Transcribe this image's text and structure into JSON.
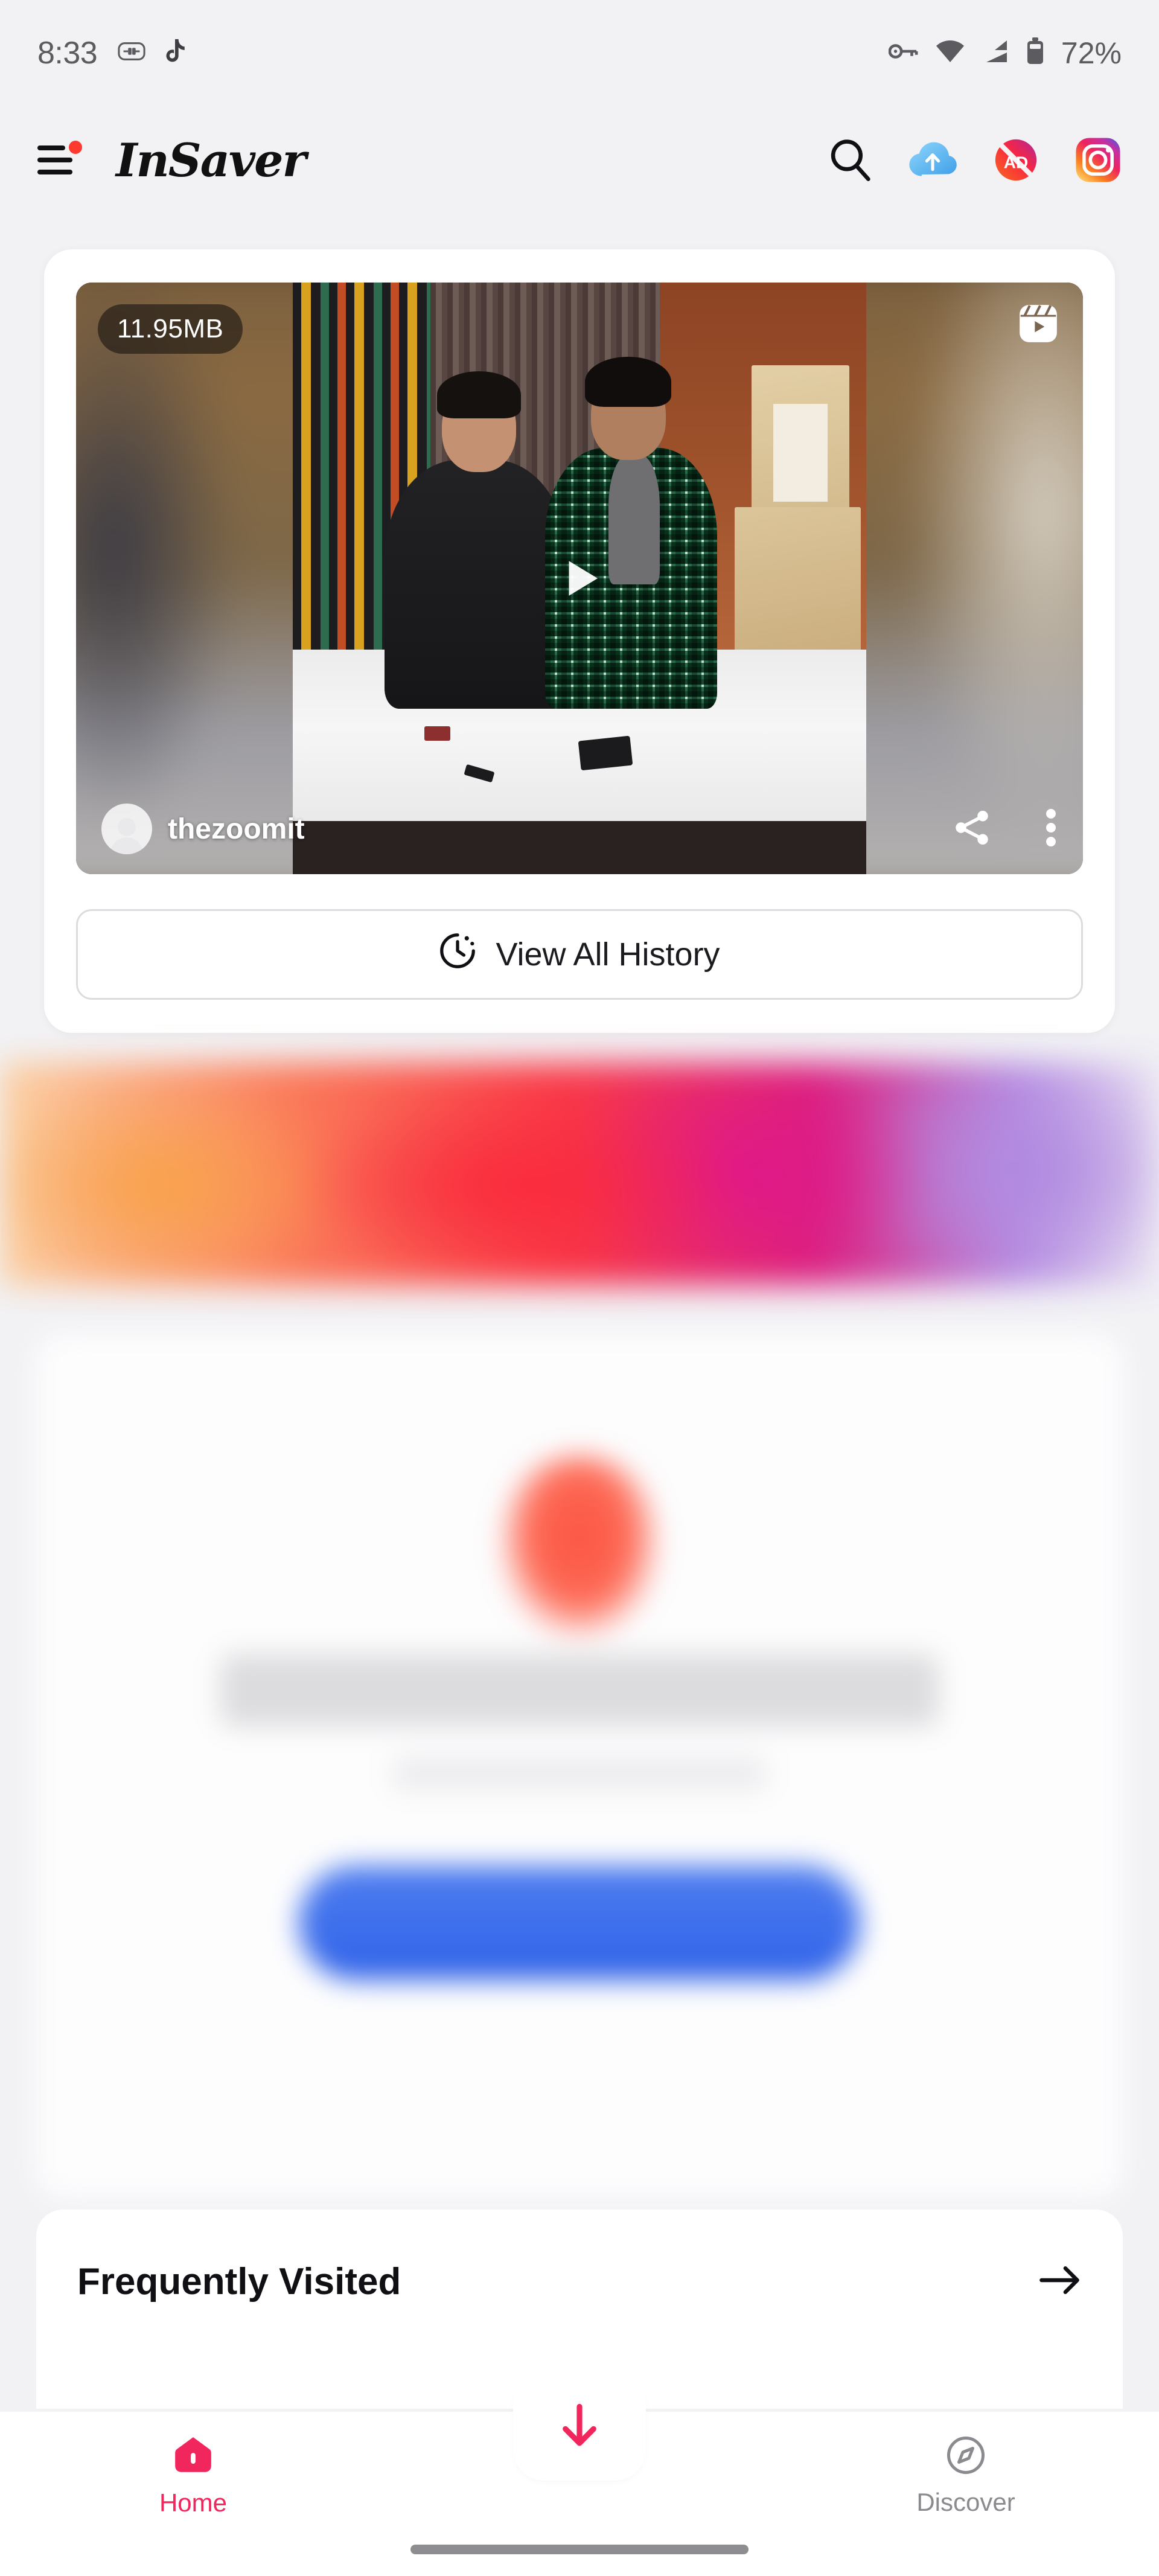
{
  "status_bar": {
    "time": "8:33",
    "battery_percent": "72%",
    "left_icons": [
      "usb-connection-icon",
      "tiktok-music-note-icon"
    ],
    "right_icons": [
      "vpn-key-icon",
      "wifi-icon",
      "cellular-signal-icon",
      "battery-icon"
    ]
  },
  "app_bar": {
    "menu_icon": "hamburger-menu-icon",
    "menu_has_notification_dot": true,
    "logo_text": "InSaver",
    "actions": [
      {
        "name": "search-icon",
        "label": "Search"
      },
      {
        "name": "cloud-upload-icon",
        "label": "Cloud Upload"
      },
      {
        "name": "no-ads-icon",
        "label": "AD"
      },
      {
        "name": "instagram-icon",
        "label": "Instagram"
      }
    ]
  },
  "history_card": {
    "video": {
      "file_size": "11.95MB",
      "username": "thezoomit",
      "source_badge": "reels-icon",
      "play_icon": "play-icon",
      "share_icon": "share-icon",
      "more_icon": "more-vertical-icon",
      "avatar": "default-avatar"
    },
    "view_all_button": {
      "label": "View All History",
      "icon": "history-clock-icon"
    }
  },
  "ads": {
    "banner": {
      "name": "blurred-ad-banner",
      "colors": [
        "#fbd2a6",
        "#f93a48",
        "#db1f7f",
        "#b78ee2"
      ]
    },
    "card": {
      "name": "blurred-ad-card",
      "logo_color": "#fb5443",
      "button_color": "#2f62e8"
    }
  },
  "frequently_visited": {
    "title": "Frequently Visited",
    "arrow_icon": "arrow-right-icon"
  },
  "bottom_nav": {
    "active_color": "#f0265c",
    "inactive_color": "#8a8a8f",
    "items": [
      {
        "label": "Home",
        "icon": "home-icon",
        "active": true
      },
      {
        "label": "Discover",
        "icon": "compass-icon",
        "active": false
      }
    ],
    "fab": {
      "name": "download-button",
      "icon": "download-arrow-icon"
    }
  }
}
